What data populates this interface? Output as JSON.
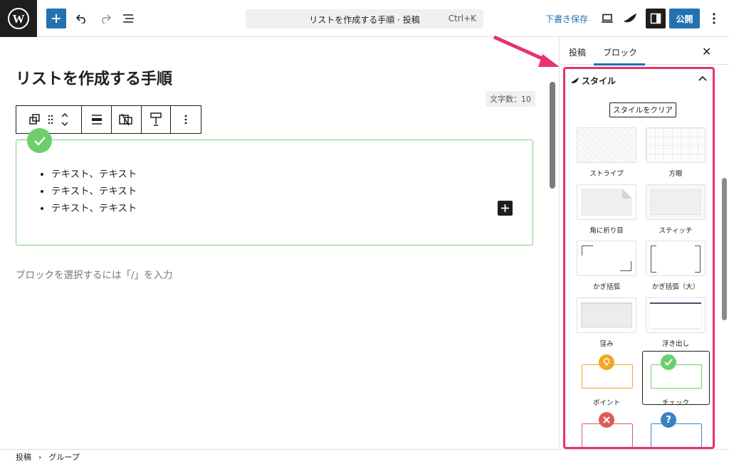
{
  "header": {
    "doc_title": "リストを作成する手順 · 投稿",
    "shortcut": "Ctrl+K",
    "draft_label": "下書き保存",
    "publish_label": "公開"
  },
  "editor": {
    "post_title": "リストを作成する手順",
    "word_count": "文字数：10",
    "list_items": [
      "テキスト、テキスト",
      "テキスト、テキスト",
      "テキスト、テキスト"
    ],
    "placeholder": "ブロックを選択するには「/」を入力"
  },
  "sidebar": {
    "tab_post": "投稿",
    "tab_block": "ブロック",
    "panel_title": "スタイル",
    "clear_label": "スタイルをクリア",
    "styles": [
      "ストライプ",
      "方眼",
      "角に折り目",
      "スティッチ",
      "かぎ括弧",
      "かぎ括弧（大）",
      "窪み",
      "浮き出し",
      "ポイント",
      "チェック"
    ]
  },
  "footer": {
    "crumb_1": "投稿",
    "crumb_2": "グループ"
  },
  "colors": {
    "accent": "#2271b1",
    "highlight": "#e8336a",
    "check_green": "#6ccf6c",
    "point_orange": "#f5a623",
    "cross_red": "#e05a5a",
    "question_blue": "#3b82c4"
  }
}
